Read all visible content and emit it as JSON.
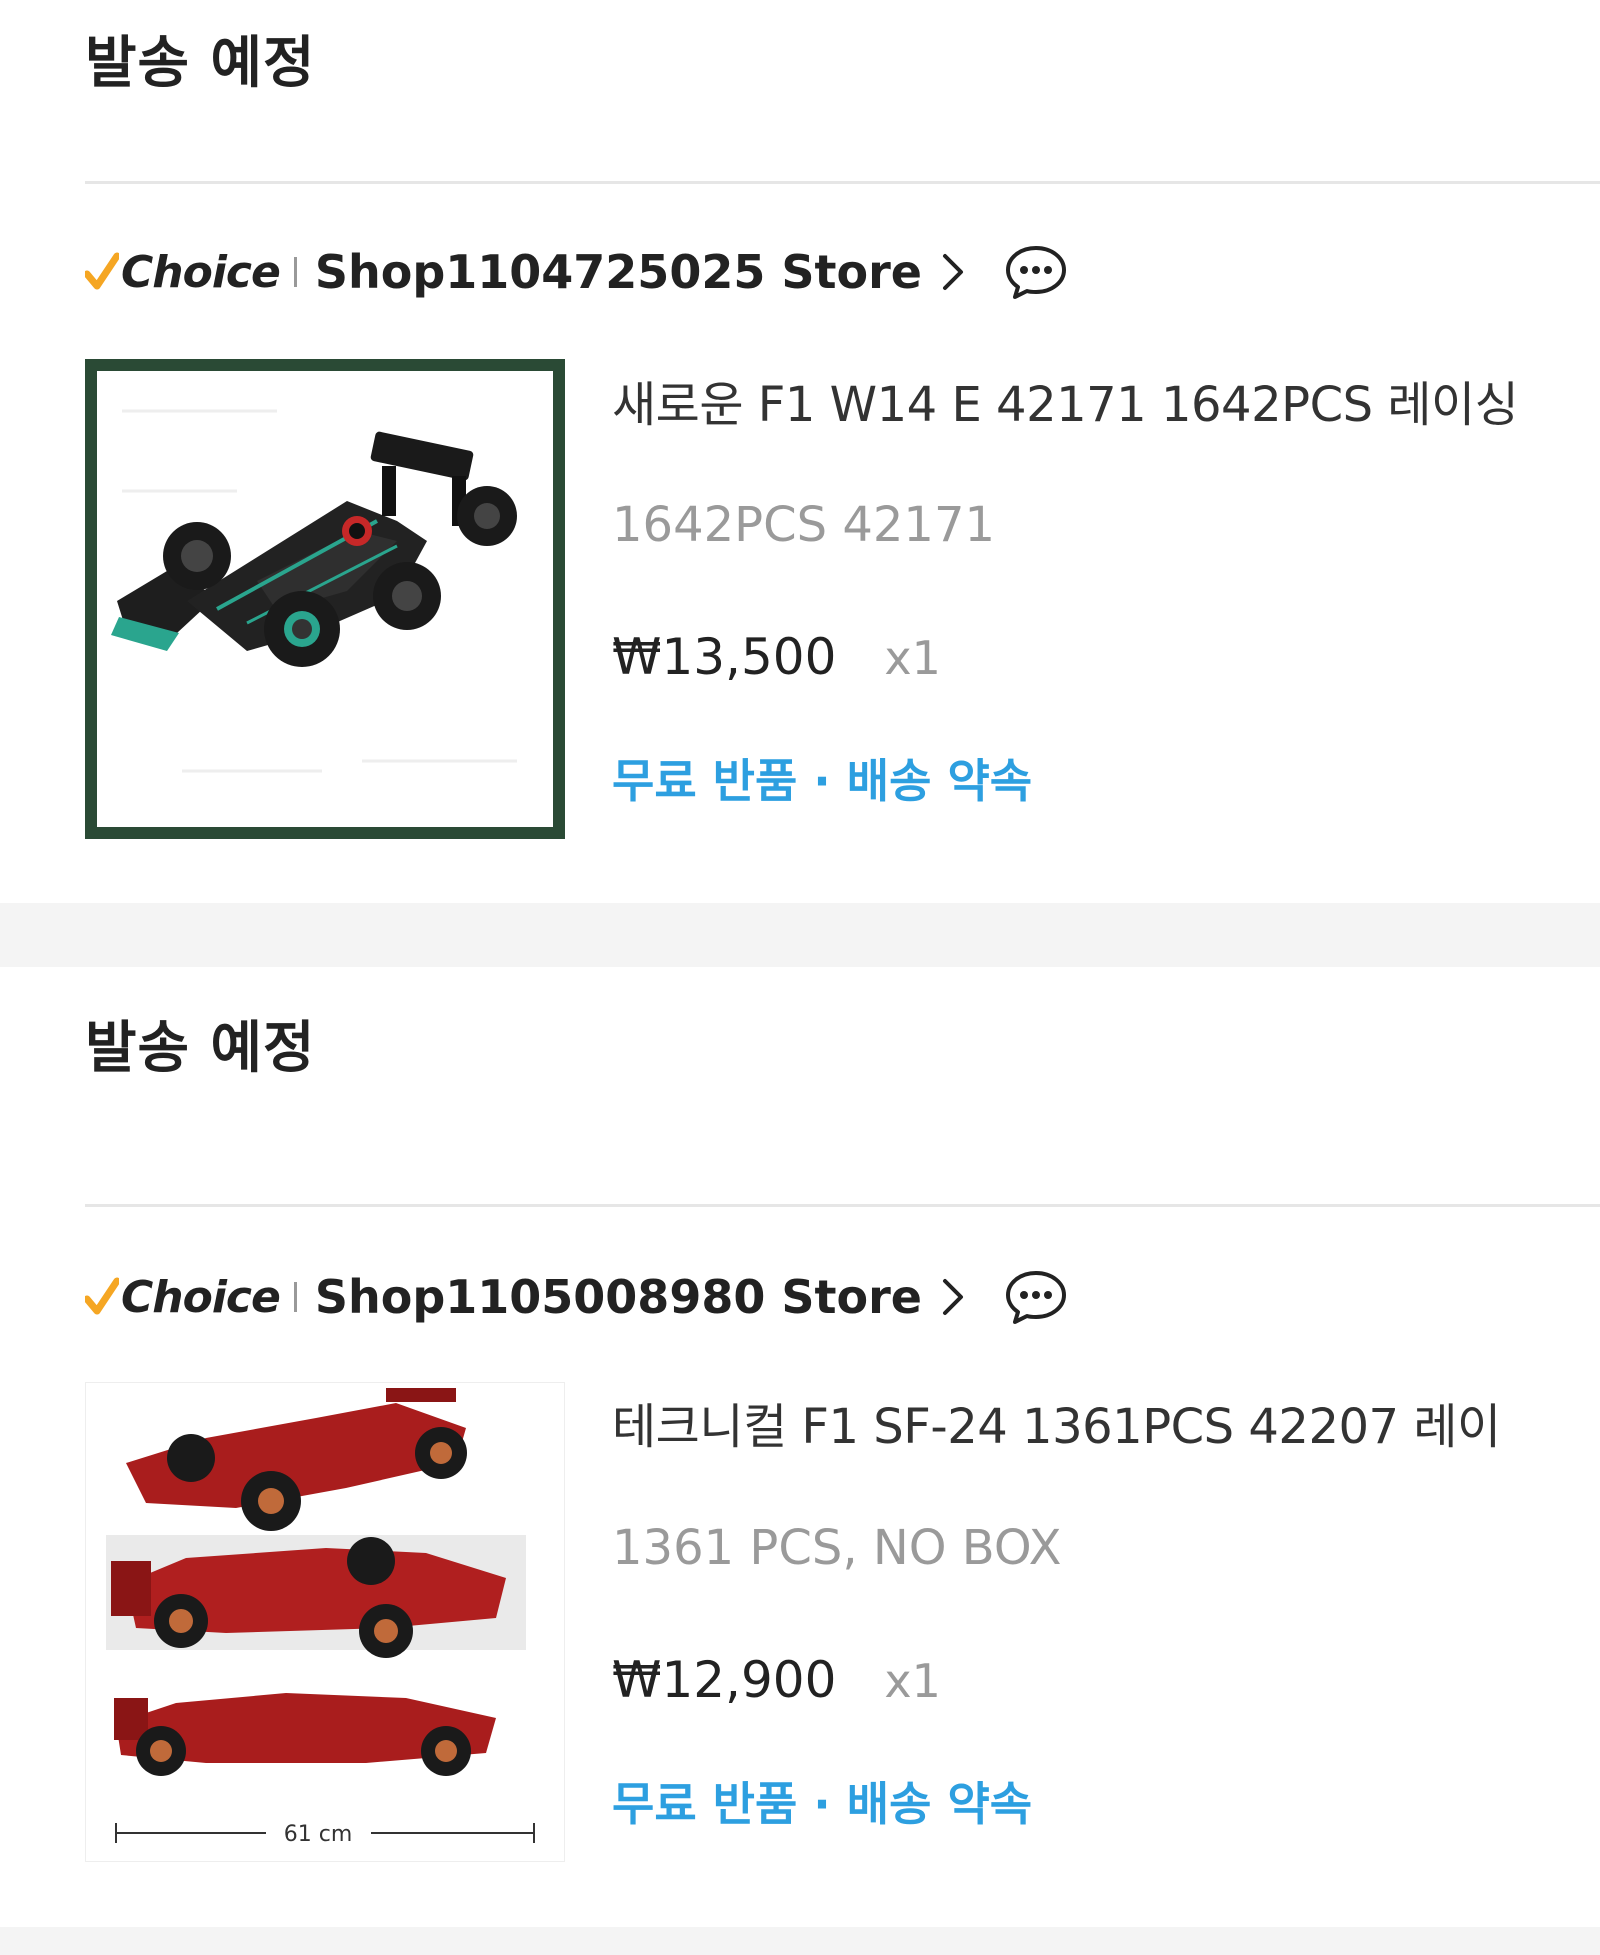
{
  "orders": [
    {
      "status_title": "발송 예정",
      "choice_label": "Choice",
      "store_name": "Shop1104725025 Store",
      "product": {
        "title": "새로운 F1 W14 E 42171 1642PCS 레이싱",
        "variant": "1642PCS 42171",
        "price": "₩13,500",
        "quantity": "x1",
        "benefits": "무료 반품 · 배송 약속"
      }
    },
    {
      "status_title": "발송 예정",
      "choice_label": "Choice",
      "store_name": "Shop1105008980 Store",
      "product": {
        "title": "테크니컬 F1 SF-24 1361PCS 42207 레이",
        "variant": "1361 PCS, NO BOX",
        "price": "₩12,900",
        "quantity": "x1",
        "benefits": "무료 반품 · 배송 약속",
        "image_caption": "61 cm"
      }
    }
  ],
  "colors": {
    "choice_check": "#f5a623",
    "benefits_text": "#2d9fe0",
    "image_border_first": "#2a4a35"
  },
  "icons": [
    "check-icon",
    "chevron-right-icon",
    "chat-icon"
  ]
}
